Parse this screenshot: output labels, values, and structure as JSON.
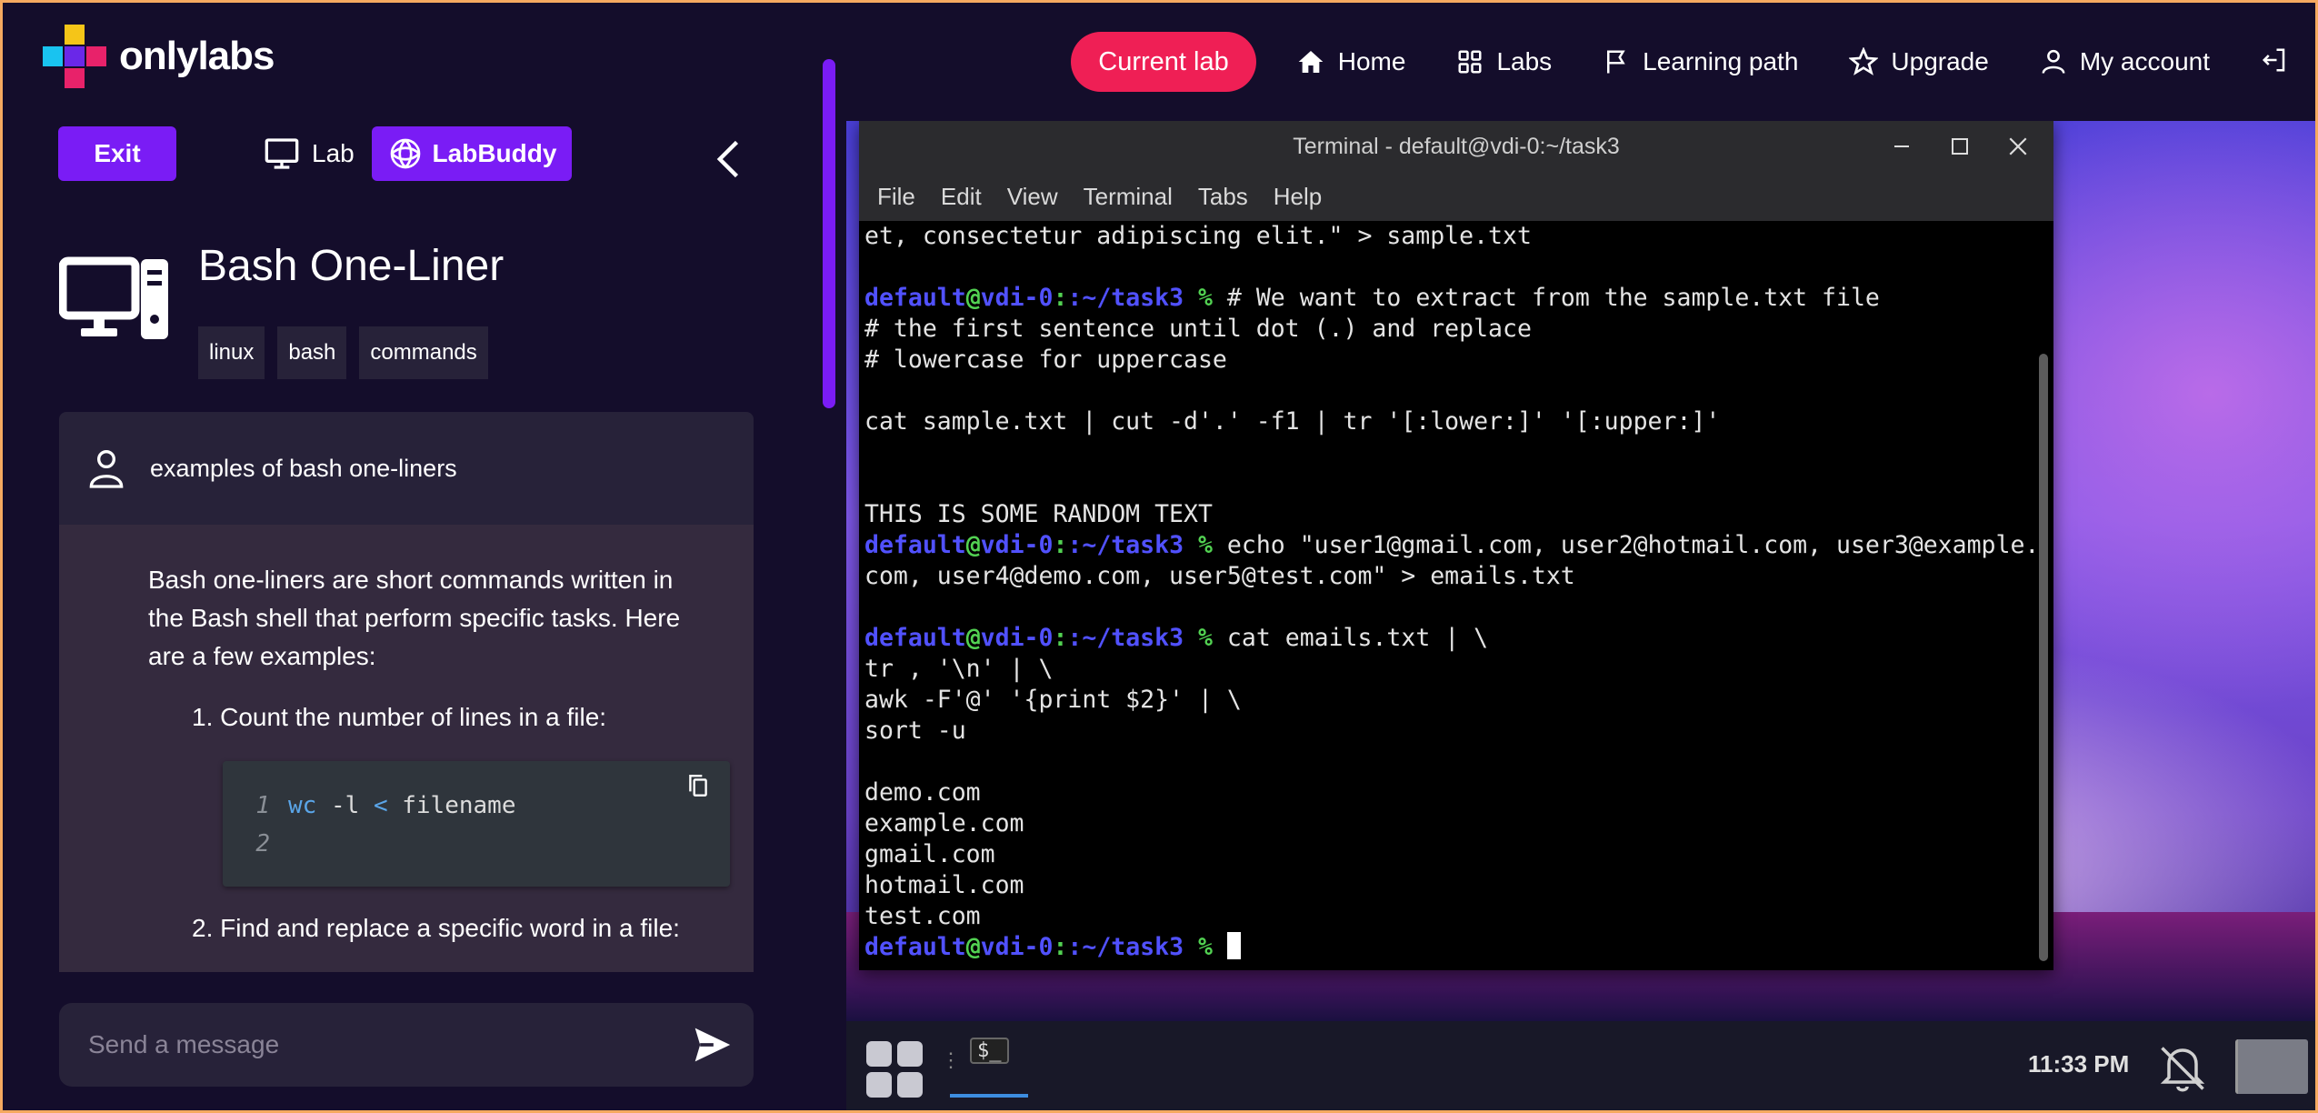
{
  "brand": {
    "name": "onlylabs"
  },
  "nav": {
    "current_lab": "Current lab",
    "home": "Home",
    "labs": "Labs",
    "learning_path": "Learning path",
    "upgrade": "Upgrade",
    "my_account": "My account"
  },
  "left_panel": {
    "exit_label": "Exit",
    "tab_lab": "Lab",
    "tab_labbuddy": "LabBuddy",
    "course_title": "Bash One-Liner",
    "tags": [
      "linux",
      "bash",
      "commands"
    ]
  },
  "chat": {
    "user_message": "examples of bash one-liners",
    "bot_intro": "Bash one-liners are short commands written in the Bash shell that perform specific tasks. Here are a few examples:",
    "item1": "1. Count the number of lines in a file:",
    "code": {
      "line_numbers": [
        "1",
        "2"
      ],
      "cmd": "wc",
      "flag": " -l ",
      "redirect": "<",
      "arg": " filename"
    },
    "item2": "2. Find and replace a specific word in a file:",
    "input_placeholder": "Send a message"
  },
  "terminal": {
    "title": "Terminal - default@vdi-0:~/task3",
    "menu": [
      "File",
      "Edit",
      "View",
      "Terminal",
      "Tabs",
      "Help"
    ],
    "prompt_user": "default",
    "prompt_host": "vdi-0",
    "prompt_path": ":~/task3",
    "prompt_sym": " %",
    "lines": {
      "l1": "et, consectetur adipiscing elit.\" > sample.txt",
      "l3": " # We want to extract from the sample.txt file",
      "l4": "# the first sentence until dot (.) and replace",
      "l5": "# lowercase for uppercase",
      "l7": "cat sample.txt | cut -d'.' -f1 | tr '[:lower:]' '[:upper:]'",
      "l10": "THIS IS SOME RANDOM TEXT",
      "l11": " echo \"user1@gmail.com, user2@hotmail.com, user3@example.",
      "l12": "com, user4@demo.com, user5@test.com\" > emails.txt",
      "l14": " cat emails.txt | \\",
      "l15": "tr , '\\n' | \\",
      "l16": "awk -F'@' '{print $2}' | \\",
      "l17": "sort -u",
      "l19": "demo.com",
      "l20": "example.com",
      "l21": "gmail.com",
      "l22": "hotmail.com",
      "l23": "test.com"
    }
  },
  "taskbar": {
    "terminal_glyph": "$_",
    "clock": "11:33 PM"
  },
  "colors": {
    "accent_purple": "#7a1cf5",
    "current_lab_red": "#ef1f55",
    "app_bg": "#140d2b",
    "prompt_blue": "#5151ff",
    "prompt_green": "#52d252"
  }
}
